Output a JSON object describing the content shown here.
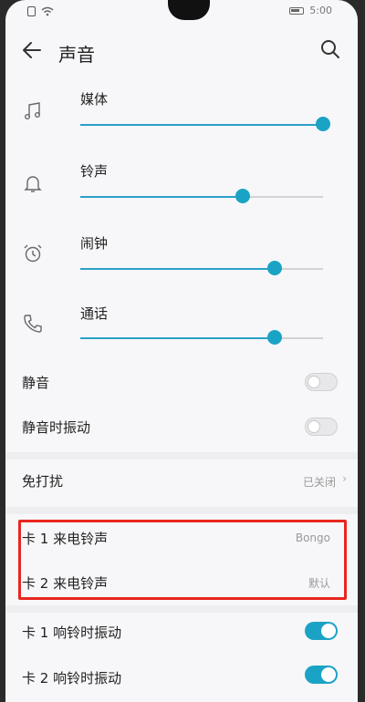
{
  "statusbar": {
    "time": "5:00",
    "left_icons": [
      "sim-icon",
      "wifi-icon"
    ],
    "right_icons": [
      "battery-icon"
    ]
  },
  "appbar": {
    "title": "声音"
  },
  "volumes": [
    {
      "label": "媒体",
      "icon": "music-note-icon",
      "level": 1.0
    },
    {
      "label": "铃声",
      "icon": "bell-icon",
      "level": 0.67
    },
    {
      "label": "闹钟",
      "icon": "alarm-clock-icon",
      "level": 0.8
    },
    {
      "label": "通话",
      "icon": "phone-icon",
      "level": 0.8
    }
  ],
  "toggles": [
    {
      "label": "静音",
      "on": false
    },
    {
      "label": "静音时振动",
      "on": false
    }
  ],
  "dnd": {
    "label": "免打扰",
    "value": "已关闭"
  },
  "ringtones": [
    {
      "label": "卡 1 来电铃声",
      "value": "Bongo"
    },
    {
      "label": "卡 2 来电铃声",
      "value": "默认"
    }
  ],
  "vibrate": [
    {
      "label": "卡 1 响铃时振动",
      "on": true
    },
    {
      "label": "卡 2 响铃时振动",
      "on": true
    }
  ],
  "colors": {
    "accent": "#1aa3c5",
    "highlight": "#e8261f"
  }
}
